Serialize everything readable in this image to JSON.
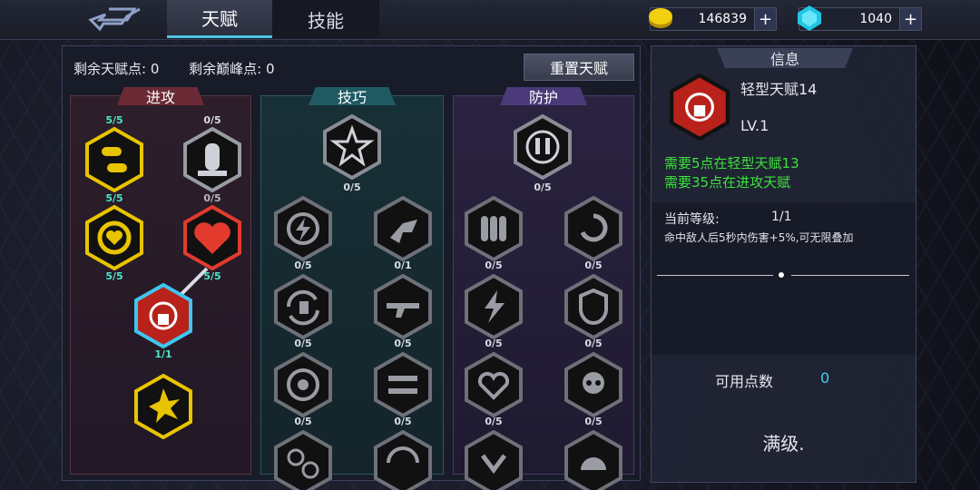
{
  "tabs": {
    "talent": "天赋",
    "skill": "技能"
  },
  "currency": {
    "gold": "146839",
    "gem": "1040",
    "plus": "+"
  },
  "points": {
    "talent": "剩余天赋点: 0",
    "peak": "剩余巅峰点: 0"
  },
  "reset": "重置天赋",
  "columns": {
    "attack": "进攻",
    "skill": "技巧",
    "defense": "防护"
  },
  "attack_labels": [
    "5/5",
    "0/5",
    "5/5",
    "0/5",
    "5/5",
    "5/5",
    "1/1"
  ],
  "skill_labels": [
    "0/5",
    "0/5",
    "0/1",
    "0/5",
    "0/5",
    "0/5",
    "0/5"
  ],
  "defense_labels": [
    "0/5",
    "0/5",
    "0/5",
    "0/5",
    "0/5",
    "0/5",
    "0/5"
  ],
  "info": {
    "header": "信息",
    "name": "轻型天赋14",
    "level": "LV.1",
    "req1": "需要5点在轻型天赋13",
    "req2": "需要35点在进攻天赋",
    "cur_label": "当前等级:",
    "cur_value": "1/1",
    "desc": "命中敌人后5秒内伤害+5%,可无限叠加",
    "avail_label": "可用点数",
    "avail_value": "0",
    "maxed": "满级."
  },
  "colors": {
    "gold": "#e8c400",
    "red": "#e23b2e",
    "cyan": "#4de6c8",
    "green": "#3ee03e",
    "blue": "#3fd0f0"
  }
}
